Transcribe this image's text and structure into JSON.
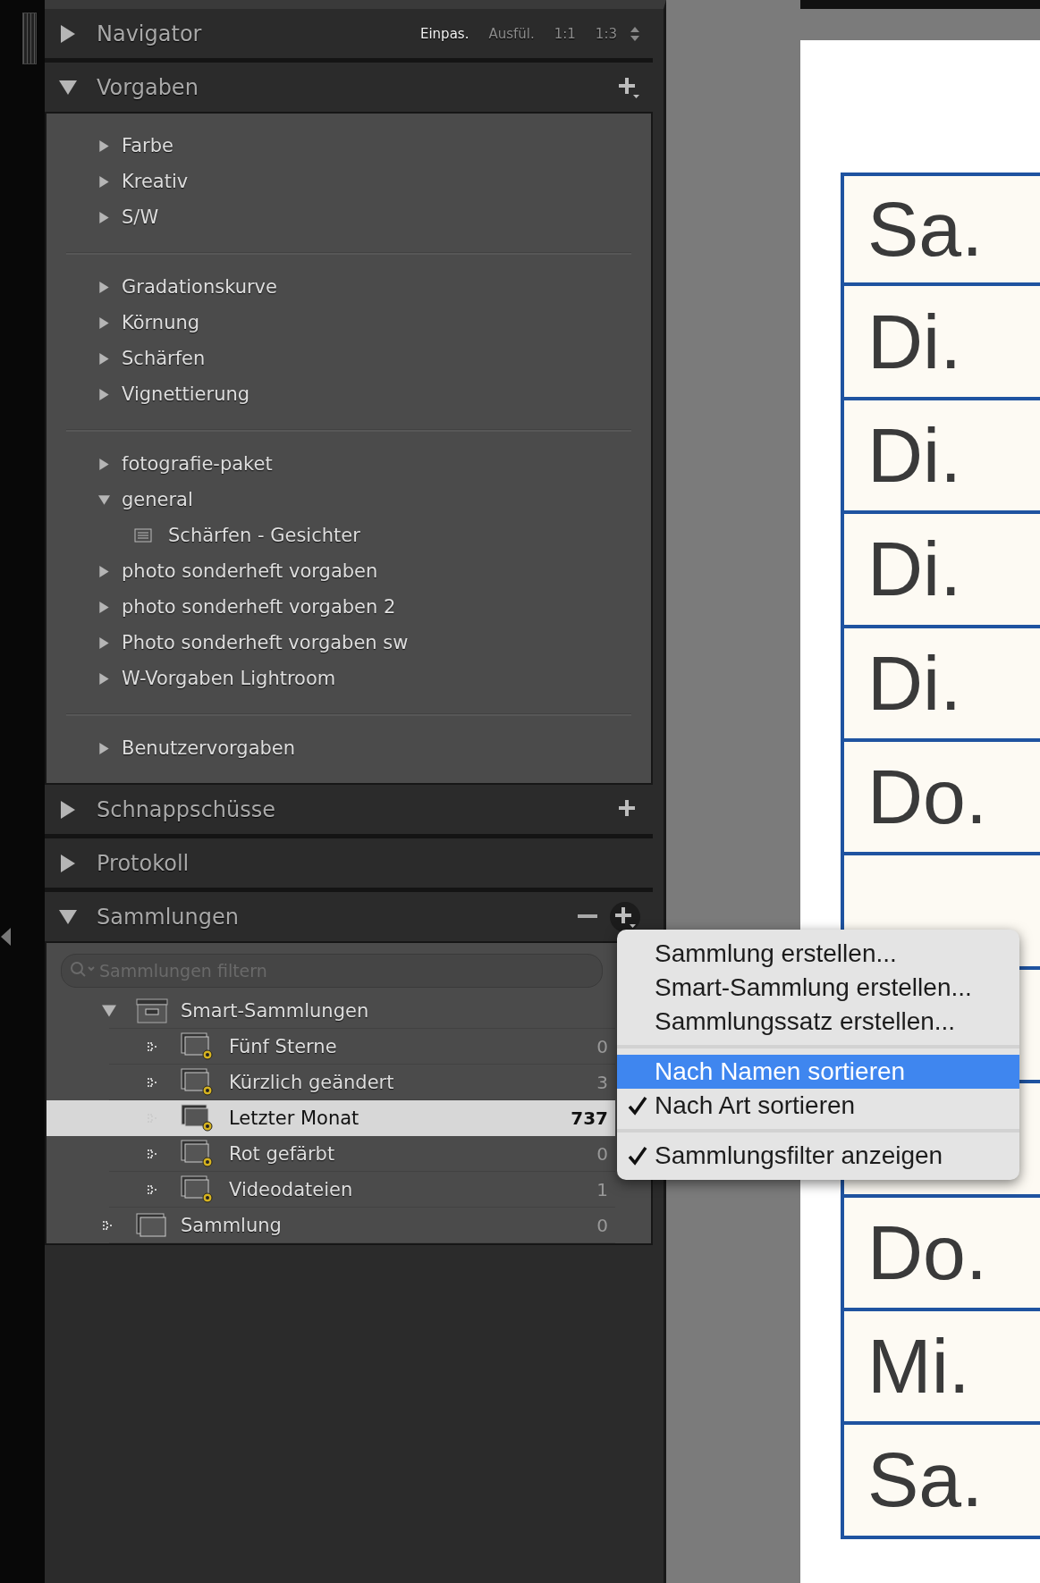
{
  "navigator": {
    "title": "Navigator",
    "expanded": false,
    "zoom_options": [
      {
        "label": "Einpas.",
        "selected": true
      },
      {
        "label": "Ausfül.",
        "selected": false
      },
      {
        "label": "1:1",
        "selected": false
      },
      {
        "label": "1:3",
        "selected": false
      }
    ]
  },
  "vorgaben": {
    "title": "Vorgaben",
    "expanded": true,
    "groups": [
      [
        {
          "label": "Farbe",
          "kind": "folder",
          "expanded": false
        },
        {
          "label": "Kreativ",
          "kind": "folder",
          "expanded": false
        },
        {
          "label": "S/W",
          "kind": "folder",
          "expanded": false
        }
      ],
      [
        {
          "label": "Gradationskurve",
          "kind": "folder",
          "expanded": false
        },
        {
          "label": "Körnung",
          "kind": "folder",
          "expanded": false
        },
        {
          "label": "Schärfen",
          "kind": "folder",
          "expanded": false
        },
        {
          "label": "Vignettierung",
          "kind": "folder",
          "expanded": false
        }
      ],
      [
        {
          "label": "fotografie-paket",
          "kind": "folder",
          "expanded": false
        },
        {
          "label": "general",
          "kind": "folder",
          "expanded": true,
          "children": [
            {
              "label": "Schärfen - Gesichter",
              "kind": "preset"
            }
          ]
        },
        {
          "label": "photo sonderheft vorgaben",
          "kind": "folder",
          "expanded": false
        },
        {
          "label": "photo sonderheft vorgaben 2",
          "kind": "folder",
          "expanded": false
        },
        {
          "label": "Photo sonderheft vorgaben sw",
          "kind": "folder",
          "expanded": false
        },
        {
          "label": "W-Vorgaben Lightroom",
          "kind": "folder",
          "expanded": false
        }
      ],
      [
        {
          "label": "Benutzervorgaben",
          "kind": "folder",
          "expanded": false
        }
      ]
    ]
  },
  "schnappschuesse": {
    "title": "Schnappschüsse",
    "expanded": false
  },
  "protokoll": {
    "title": "Protokoll",
    "expanded": false
  },
  "sammlungen": {
    "title": "Sammlungen",
    "expanded": true,
    "filter": {
      "placeholder": "Sammlungen filtern"
    },
    "items": [
      {
        "label": "Smart-Sammlungen",
        "kind": "set",
        "expanded": true,
        "children": [
          {
            "label": "Fünf Sterne",
            "kind": "smart",
            "count": "0",
            "selected": false
          },
          {
            "label": "Kürzlich geändert",
            "kind": "smart",
            "count": "3",
            "selected": false
          },
          {
            "label": "Letzter Monat",
            "kind": "smart",
            "count": "737",
            "selected": true
          },
          {
            "label": "Rot gefärbt",
            "kind": "smart",
            "count": "0",
            "selected": false
          },
          {
            "label": "Videodateien",
            "kind": "smart",
            "count": "1",
            "selected": false
          }
        ]
      },
      {
        "label": "Sammlung",
        "kind": "collection",
        "count": "0",
        "selected": false
      }
    ]
  },
  "menu": {
    "groups": [
      [
        {
          "label": "Sammlung erstellen...",
          "checked": false,
          "selected": false
        },
        {
          "label": "Smart-Sammlung erstellen...",
          "checked": false,
          "selected": false
        },
        {
          "label": "Sammlungssatz erstellen...",
          "checked": false,
          "selected": false
        }
      ],
      [
        {
          "label": "Nach Namen sortieren",
          "checked": false,
          "selected": true
        },
        {
          "label": "Nach Art sortieren",
          "checked": true,
          "selected": false
        }
      ],
      [
        {
          "label": "Sammlungsfilter anzeigen",
          "checked": true,
          "selected": false
        }
      ]
    ]
  },
  "document": {
    "rows": [
      {
        "text": "Sa."
      },
      {
        "text": "Di."
      },
      {
        "text": "Di."
      },
      {
        "text": "Di."
      },
      {
        "text": "Di."
      },
      {
        "text": "Do."
      },
      {},
      {},
      {},
      {
        "text": "Do."
      },
      {
        "text": "Mi."
      },
      {
        "text": "Sa."
      }
    ]
  }
}
